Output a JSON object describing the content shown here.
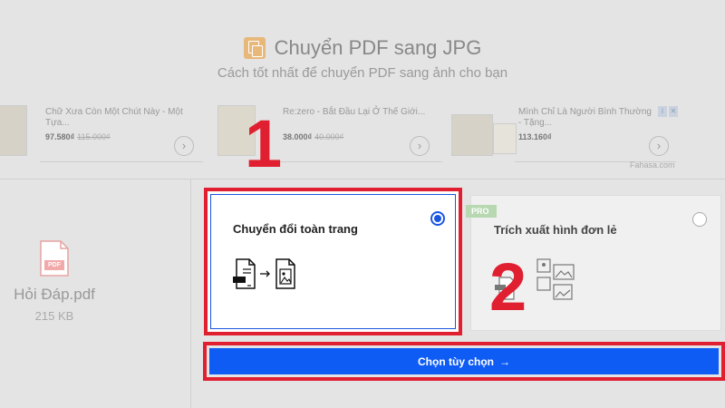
{
  "header": {
    "title": "Chuyển PDF sang JPG",
    "subtitle": "Cách tốt nhất để chuyển PDF sang ảnh cho bạn"
  },
  "ads": {
    "items": [
      {
        "title": "Chữ Xưa Còn Một Chút Này - Một Tựa...",
        "price": "97.580₫",
        "old_price": "115.000₫"
      },
      {
        "title": "Re:zero - Bắt Đầu Lại Ở Thế Giới...",
        "price": "38.000₫",
        "old_price": "40.000₫"
      },
      {
        "title": "Mình Chỉ Là Người Bình Thường - Tặng...",
        "price": "113.160₫",
        "old_price": ""
      }
    ],
    "source": "Fahasa.com",
    "arrow_icon": "chevron-right-icon"
  },
  "file": {
    "name": "Hỏi Đáp.pdf",
    "size": "215 KB",
    "icon_label": "PDF"
  },
  "options": {
    "full_page": {
      "label": "Chuyển đổi toàn trang",
      "selected": true
    },
    "extract_images": {
      "label": "Trích xuất hình đơn lẻ",
      "selected": false,
      "badge": "PRO"
    }
  },
  "annotations": {
    "step1": "1",
    "step2": "2"
  },
  "action": {
    "label": "Chọn tùy chọn",
    "arrow": "→"
  },
  "colors": {
    "accent": "#0f5cf5",
    "annotation": "#e02030",
    "pro": "#b7d8b1"
  }
}
